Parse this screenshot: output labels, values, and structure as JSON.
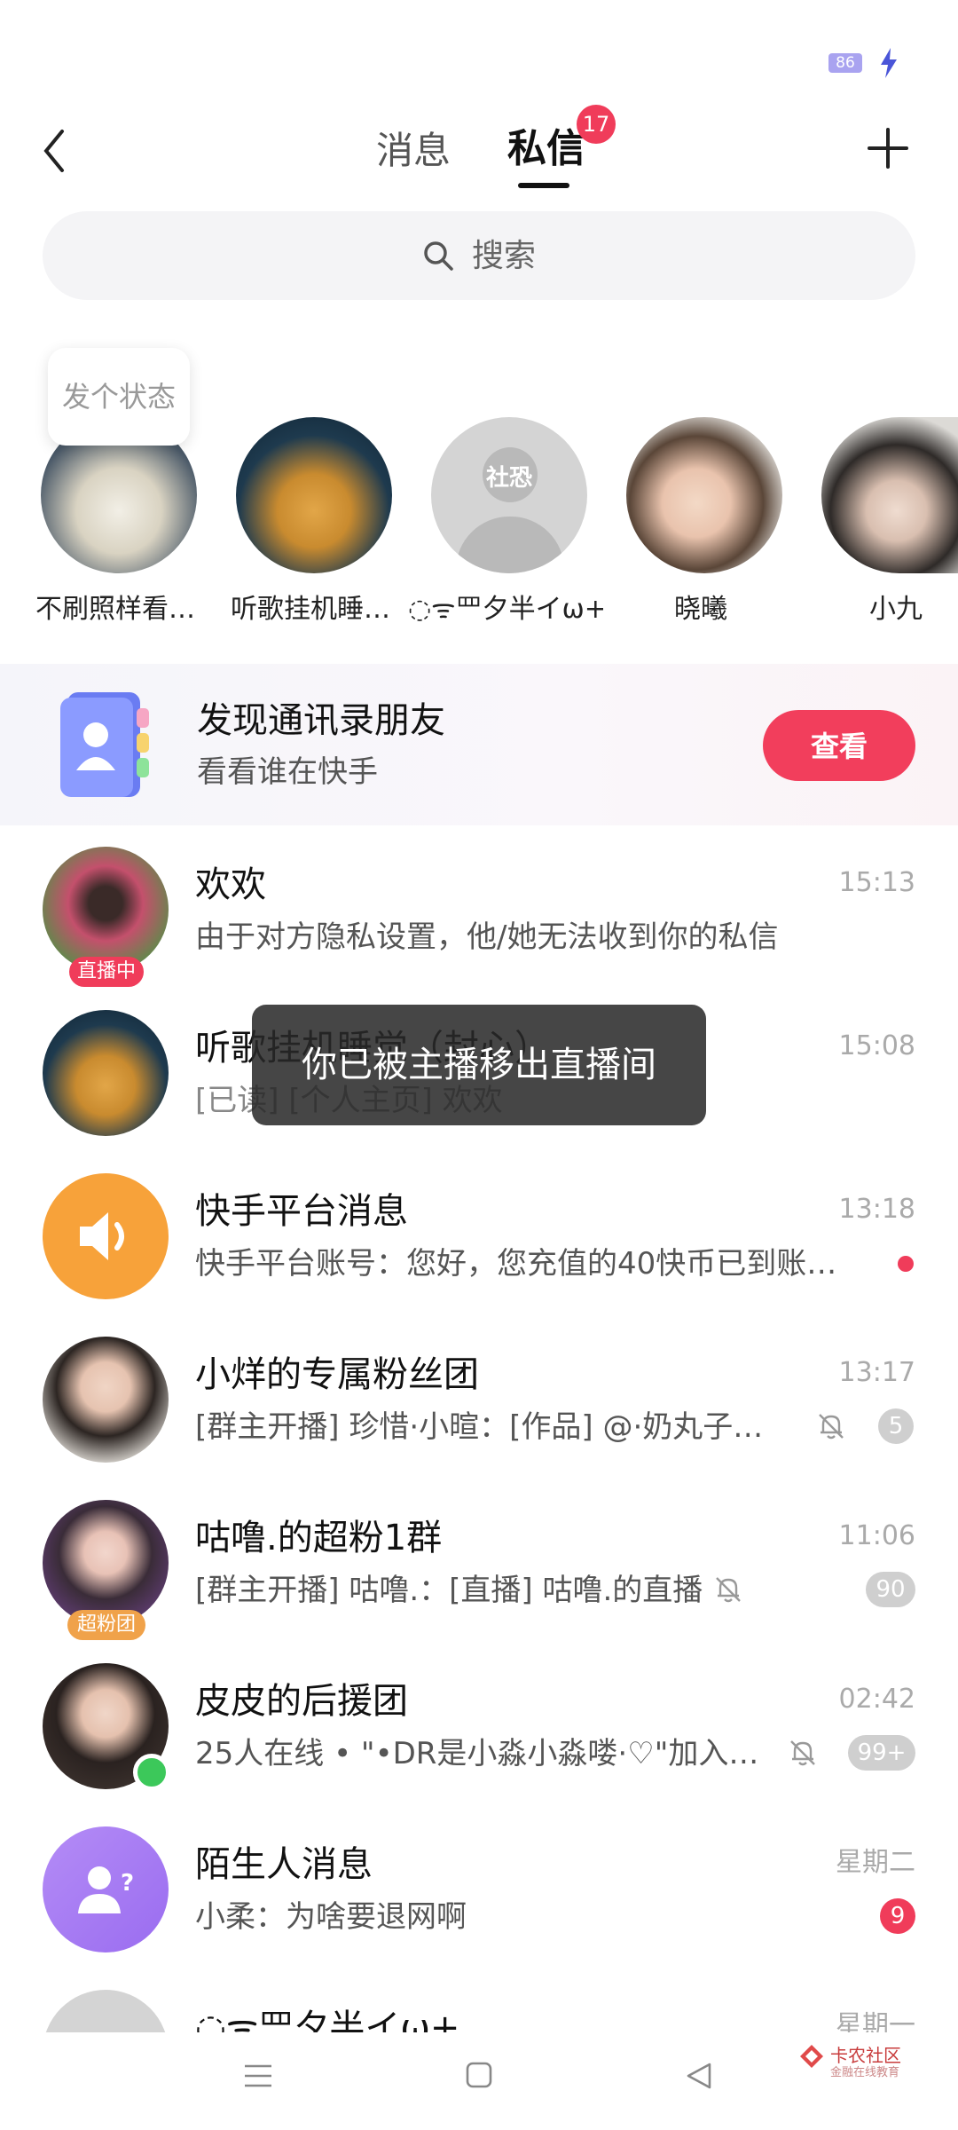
{
  "status_bar": {
    "battery": "86"
  },
  "header": {
    "tabs": [
      {
        "label": "消息"
      },
      {
        "label": "私信",
        "badge": "17",
        "active": true
      }
    ]
  },
  "search": {
    "placeholder": "搜索"
  },
  "stories": {
    "status_prompt": "发个状态",
    "items": [
      {
        "label": "不刷照样看…"
      },
      {
        "label": "听歌挂机睡…"
      },
      {
        "label": "◌ᯤ罒夕半イω+",
        "avatar_text": "社恐"
      },
      {
        "label": "晓曦"
      },
      {
        "label": "小九"
      }
    ]
  },
  "contacts_banner": {
    "title": "发现通讯录朋友",
    "subtitle": "看看谁在快手",
    "button": "查看"
  },
  "chats": [
    {
      "name": "欢欢",
      "preview": "由于对方隐私设置，他/她无法收到你的私信",
      "time": "15:13",
      "tag": "直播中"
    },
    {
      "name": "听歌挂机睡觉（封心）",
      "preview": "[已读] [个人主页] 欢欢",
      "time": "15:08"
    },
    {
      "name": "快手平台消息",
      "preview": "快手平台账号：您好，您充值的40快币已到账…",
      "time": "13:18",
      "unread_dot": true
    },
    {
      "name": "小烊的专属粉丝团",
      "preview": "[群主开播] 珍惜·小暄：[作品] @·奶丸子…",
      "time": "13:17",
      "count": "5",
      "muted": true
    },
    {
      "name": "咕噜.的超粉1群",
      "preview": "[群主开播] 咕噜.：[直播] 咕噜.的直播",
      "time": "11:06",
      "count": "90",
      "muted": true,
      "tag": "超粉团"
    },
    {
      "name": "皮皮的后援团",
      "preview": "25人在线 • \"•DR是小淼小淼喽·♡\"加入…",
      "time": "02:42",
      "count": "99+",
      "muted": true
    },
    {
      "name": "陌生人消息",
      "preview": "小柔：为啥要退网啊",
      "time": "星期二",
      "count": "9"
    },
    {
      "name": "◌ᯤ罒夕半イω+",
      "preview": "",
      "time": "星期一"
    }
  ],
  "toast": "你已被主播移出直播间",
  "watermark": {
    "title": "卡农社区",
    "subtitle": "金融在线教育"
  },
  "colors": {
    "accent": "#f03c5a",
    "platform_orange": "#f7a23a",
    "stranger_purple": "#a777f2"
  }
}
